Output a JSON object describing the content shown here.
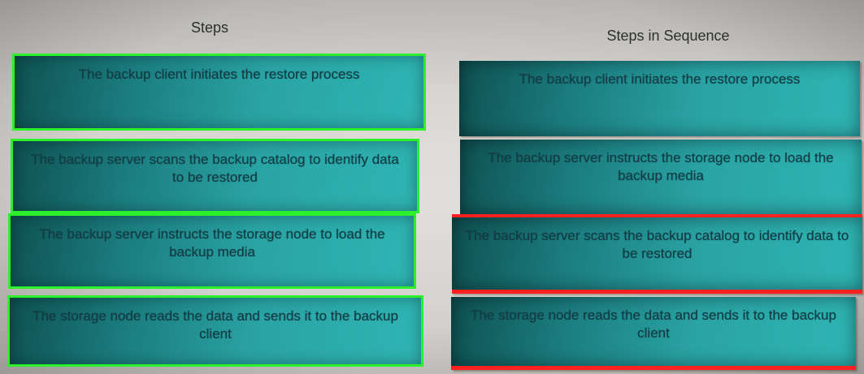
{
  "steps_column": {
    "title": "Steps",
    "items": [
      {
        "text": "The backup client initiates the restore process",
        "status": "selected",
        "outline_color": "#2df02d"
      },
      {
        "text": "The backup server scans the backup catalog to identify data to be restored",
        "status": "selected",
        "outline_color": "#2df02d"
      },
      {
        "text": "The backup server instructs the storage node to load the backup media",
        "status": "selected",
        "outline_color": "#2df02d"
      },
      {
        "text": "The storage node reads the data and sends it to the backup client",
        "status": "selected",
        "outline_color": "#2df02d"
      }
    ]
  },
  "sequence_column": {
    "title": "Steps in Sequence",
    "items": [
      {
        "text": "The backup client initiates the restore process",
        "status": "placed"
      },
      {
        "text": "The backup server instructs the storage node to load the backup media",
        "status": "placed"
      },
      {
        "text": "The backup server scans the backup catalog to identify data to be restored",
        "status": "incorrect",
        "marker_color": "#ff2020"
      },
      {
        "text": "The storage node reads the data and sends it to the backup client",
        "status": "incorrect",
        "marker_color": "#ff2020"
      }
    ]
  },
  "colors": {
    "tile_teal": "#2aa3a4",
    "correct_outline": "#2df02d",
    "error_marker": "#ff2020"
  }
}
